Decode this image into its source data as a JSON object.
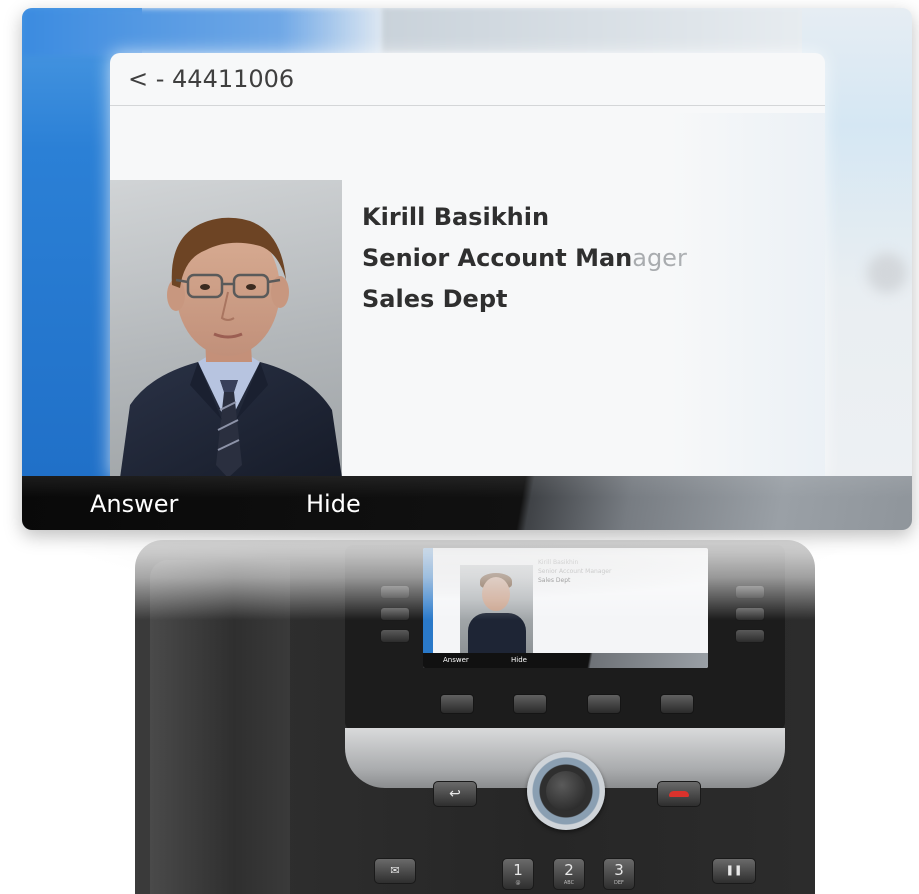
{
  "call": {
    "number_line": "< - 44411006"
  },
  "contact": {
    "name": "Kirill Basikhin",
    "title_main": "Senior Account Man",
    "title_faded": "ager",
    "department": "Sales Dept"
  },
  "softkeys": {
    "answer": "Answer",
    "hide": "Hide"
  },
  "keypad": {
    "keys": [
      {
        "digit": "1",
        "letters": "@"
      },
      {
        "digit": "2",
        "letters": "ABC"
      },
      {
        "digit": "3",
        "letters": "DEF"
      }
    ],
    "back_glyph": "↩",
    "hold_glyph": "❚❚",
    "msg_glyph": "✉"
  },
  "colors": {
    "accent_blue": "#2b80d6",
    "softbar_black": "#0d0d0d",
    "end_call_red": "#d9322c"
  }
}
